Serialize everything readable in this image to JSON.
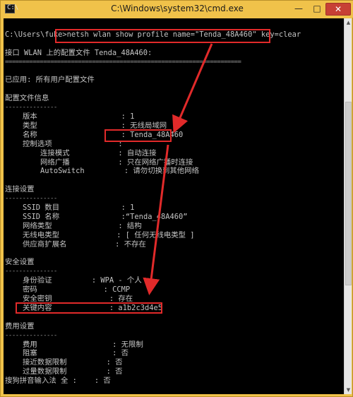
{
  "window": {
    "title": "C:\\Windows\\system32\\cmd.exe",
    "icon_text": "C:\\",
    "minimize_label": "—",
    "maximize_label": "□",
    "close_label": "✕"
  },
  "console": {
    "lines": [
      {
        "text": "",
        "y": 0
      },
      {
        "text": "C:\\Users\\fuke>netsh wlan show profile name=\"Tenda_48A460\" key=clear",
        "y": 1
      },
      {
        "text": "",
        "y": 2
      },
      {
        "text": "接口 WLAN 上的配置文件 Tenda_48A460:",
        "y": 3
      },
      {
        "text": "====================================================================",
        "y": 4,
        "sep": true
      },
      {
        "text": "",
        "y": 5
      },
      {
        "text": "已应用: 所有用户配置文件",
        "y": 6
      },
      {
        "text": "",
        "y": 7
      },
      {
        "text": "配置文件信息",
        "y": 8
      },
      {
        "text": "---------------",
        "y": 9,
        "sep": true
      },
      {
        "text": "    版本                   : 1",
        "y": 10
      },
      {
        "text": "    类型                   : 无线局域网",
        "y": 11
      },
      {
        "text": "    名称                   : Tenda_48A460",
        "y": 12
      },
      {
        "text": "    控制选项               :",
        "y": 13
      },
      {
        "text": "        连接模式           : 自动连接",
        "y": 14
      },
      {
        "text": "        网络广播           : 只在网络广播时连接",
        "y": 15
      },
      {
        "text": "        AutoSwitch         : 请勿切换到其他网络",
        "y": 16
      },
      {
        "text": "",
        "y": 17
      },
      {
        "text": "连接设置",
        "y": 18
      },
      {
        "text": "---------------",
        "y": 19,
        "sep": true
      },
      {
        "text": "    SSID 数目              : 1",
        "y": 20
      },
      {
        "text": "    SSID 名称              :“Tenda_48A460”",
        "y": 21
      },
      {
        "text": "    网络类型               : 结构",
        "y": 22
      },
      {
        "text": "    无线电类型             : [ 任何无线电类型 ]",
        "y": 23
      },
      {
        "text": "    供应商扩展名           : 不存在",
        "y": 24
      },
      {
        "text": "",
        "y": 25
      },
      {
        "text": "安全设置",
        "y": 26
      },
      {
        "text": "---------------",
        "y": 27,
        "sep": true
      },
      {
        "text": "    身份验证         : WPA - 个人",
        "y": 28
      },
      {
        "text": "    密码               : CCMP",
        "y": 29
      },
      {
        "text": "    安全密钥             : 存在",
        "y": 30
      },
      {
        "text": "    关键内容             : a1b2c3d4e5",
        "y": 31
      },
      {
        "text": "",
        "y": 32
      },
      {
        "text": "费用设置",
        "y": 33
      },
      {
        "text": "---------------",
        "y": 34,
        "sep": true
      },
      {
        "text": "    费用                 : 无限制",
        "y": 35
      },
      {
        "text": "    阻塞                 : 否",
        "y": 36
      },
      {
        "text": "    接近数据限制         : 否",
        "y": 37
      },
      {
        "text": "    过量数据限制         : 否",
        "y": 38
      },
      {
        "text": "搜狗拼音输入法 全 :    : 否",
        "y": 39
      }
    ]
  },
  "scrollbar": {
    "up_icon": "▲",
    "down_icon": "▼"
  },
  "highlight_color": "#e12a2a"
}
